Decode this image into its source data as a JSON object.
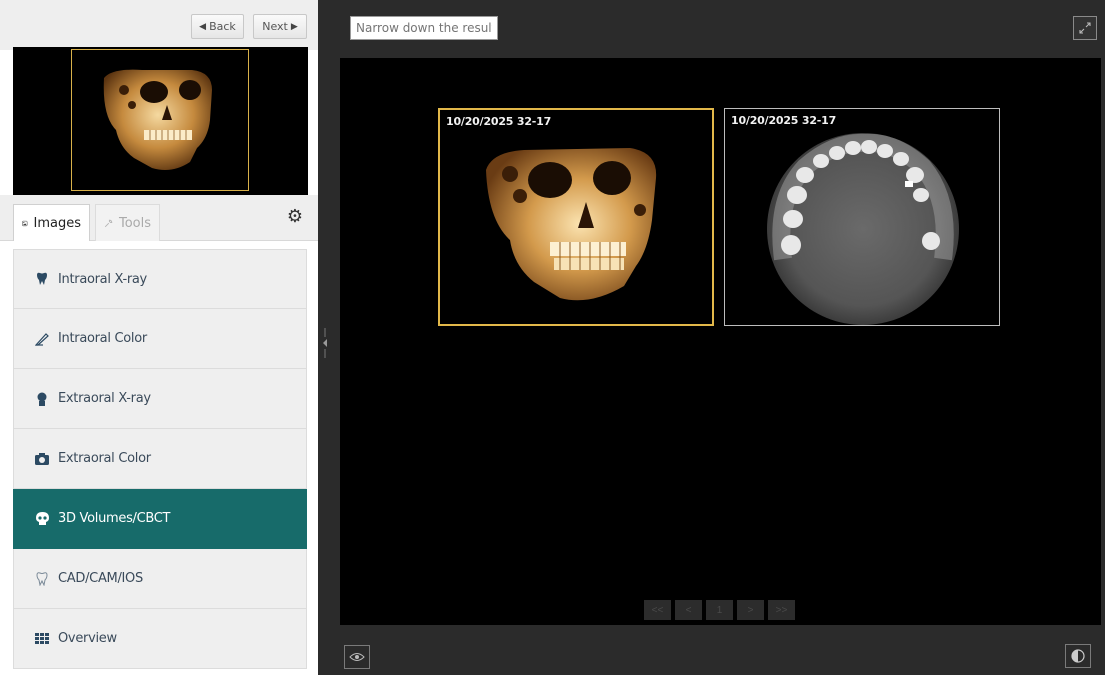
{
  "nav": {
    "back_label": "Back",
    "next_label": "Next"
  },
  "tabs": [
    {
      "label": "Images",
      "icon": "image-icon",
      "active": true
    },
    {
      "label": "Tools",
      "icon": "wrench-icon",
      "active": false
    }
  ],
  "categories": [
    {
      "label": "Intraoral X-ray",
      "icon": "tooth-icon"
    },
    {
      "label": "Intraoral Color",
      "icon": "intraoral-camera-icon"
    },
    {
      "label": "Extraoral X-ray",
      "icon": "head-silhouette-icon"
    },
    {
      "label": "Extraoral Color",
      "icon": "camera-icon"
    },
    {
      "label": "3D Volumes/CBCT",
      "icon": "skull-icon",
      "active": true
    },
    {
      "label": "CAD/CAM/IOS",
      "icon": "tooth-outline-icon"
    },
    {
      "label": "Overview",
      "icon": "grid-icon"
    }
  ],
  "search": {
    "placeholder": "Narrow down the results"
  },
  "images": [
    {
      "label": "10/20/2025 32-17",
      "kind": "3d-skull-render",
      "selected": true
    },
    {
      "label": "10/20/2025  32-17",
      "kind": "axial-cbct-slice",
      "selected": false
    }
  ],
  "pager": {
    "first": "<<",
    "prev": "<",
    "page": "1",
    "next": ">",
    "last": ">>"
  },
  "colors": {
    "accent": "#176b6a",
    "selection": "#e2b84a",
    "viewer_bg": "#000000",
    "chrome_bg": "#2b2b2b"
  }
}
